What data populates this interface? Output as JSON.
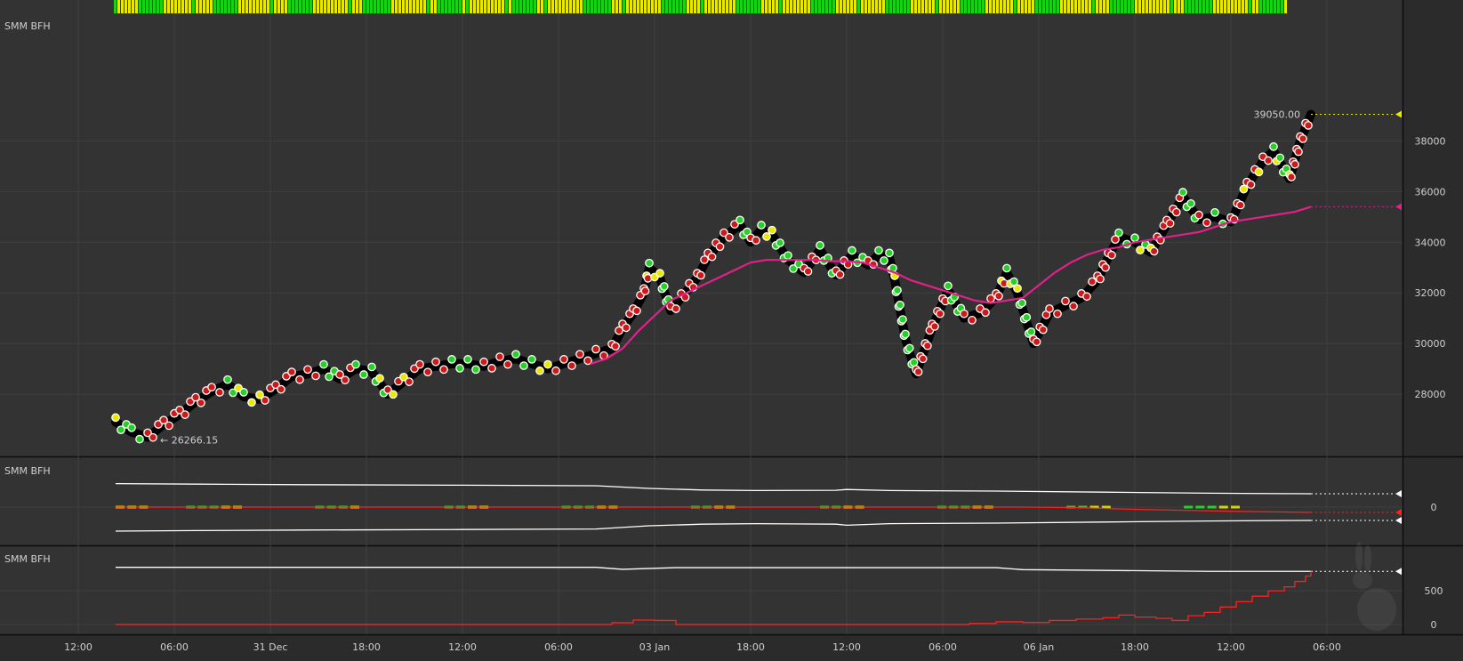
{
  "colors": {
    "background": "#2b2b2b",
    "panel": "#333333",
    "grid": "#3f3f3f",
    "axis_text": "#cfcfcf",
    "price_wick": "#000000",
    "ma_line": "#e0218a",
    "band_line": "#ffffff",
    "osc_red": "#ff2020",
    "osc_green": "#27d027",
    "osc_yellow": "#d4d400",
    "marker_green": "#27d027",
    "marker_red": "#cc1a1a",
    "marker_yellow": "#e8e800",
    "heat_yellow": "#e8e800",
    "heat_green": "#14d414",
    "last_price_arrow": "#e8e800"
  },
  "panels": [
    {
      "label": "SMM BFH"
    },
    {
      "label": "SMM BFH"
    },
    {
      "label": "SMM BFH"
    }
  ],
  "x_axis": {
    "labels": [
      "12:00",
      "06:00",
      "31 Dec",
      "18:00",
      "12:00",
      "06:00",
      "03 Jan",
      "18:00",
      "12:00",
      "06:00",
      "06 Jan",
      "18:00",
      "12:00",
      "06:00"
    ],
    "hours": [
      -12,
      6,
      24,
      42,
      60,
      78,
      96,
      114,
      132,
      150,
      168,
      186,
      204,
      222
    ]
  },
  "chart_data": [
    {
      "type": "line",
      "title": "SMM BFH",
      "x_unit": "hours since 30 Dec 00:00",
      "ylim": [
        26000,
        39700
      ],
      "y_ticks": [
        28000,
        30000,
        32000,
        34000,
        36000,
        38000
      ],
      "y_tick_labels": [
        "28000",
        "30000",
        "32000",
        "34000",
        "36000",
        "38000"
      ],
      "series": [
        {
          "role": "price",
          "x": [
            -5,
            -2,
            1,
            4,
            7,
            10,
            13,
            16,
            19,
            22,
            25,
            28,
            31,
            34,
            37,
            40,
            43,
            46,
            49,
            52,
            55,
            58,
            61,
            64,
            67,
            70,
            73,
            76,
            79,
            82,
            85,
            88,
            90,
            92,
            94,
            95,
            97,
            99,
            101,
            104,
            106,
            109,
            112,
            114,
            116,
            118,
            121,
            124,
            127,
            130,
            133,
            136,
            138,
            140,
            141,
            143,
            145,
            148,
            151,
            154,
            157,
            160,
            162,
            164,
            167,
            170,
            173,
            176,
            179,
            181,
            183,
            186,
            189,
            192,
            195,
            198,
            201,
            204,
            207,
            210,
            212,
            215,
            217,
            219
          ],
          "values": [
            26900,
            26500,
            26300,
            26800,
            27200,
            27700,
            28100,
            28400,
            27900,
            27800,
            28200,
            28700,
            28800,
            29000,
            28600,
            29000,
            28900,
            28000,
            28500,
            29000,
            29100,
            29200,
            29200,
            29100,
            29300,
            29400,
            29200,
            29000,
            29200,
            29400,
            29600,
            29800,
            30600,
            31200,
            32000,
            33000,
            32600,
            31300,
            31800,
            32600,
            33400,
            34200,
            34700,
            34000,
            34500,
            34300,
            33300,
            32800,
            33700,
            32700,
            33500,
            33100,
            33500,
            33400,
            32500,
            30200,
            28800,
            30600,
            32100,
            31000,
            31200,
            31800,
            32800,
            32000,
            30000,
            31200,
            31500,
            31800,
            32500,
            33400,
            34200,
            34000,
            33600,
            34700,
            35800,
            34900,
            35000,
            34800,
            36200,
            37200,
            37600,
            36500,
            38000,
            39050
          ]
        },
        {
          "role": "moving_average",
          "x": [
            84,
            87,
            90,
            93,
            96,
            99,
            102,
            105,
            108,
            111,
            114,
            117,
            120,
            123,
            126,
            129,
            132,
            135,
            138,
            141,
            144,
            147,
            150,
            153,
            156,
            159,
            162,
            165,
            168,
            171,
            174,
            177,
            180,
            183,
            186,
            189,
            192,
            195,
            198,
            201,
            204,
            207,
            210,
            213,
            216,
            219
          ],
          "values": [
            29200,
            29400,
            29800,
            30500,
            31100,
            31700,
            32000,
            32300,
            32600,
            32900,
            33200,
            33300,
            33300,
            33300,
            33300,
            33250,
            33250,
            33200,
            33000,
            32800,
            32500,
            32300,
            32100,
            31900,
            31700,
            31600,
            31700,
            31800,
            32300,
            32800,
            33200,
            33500,
            33700,
            33800,
            34000,
            34100,
            34200,
            34300,
            34400,
            34600,
            34800,
            34900,
            35000,
            35100,
            35200,
            35400
          ]
        }
      ],
      "annotations": {
        "last_price": {
          "value": 39050,
          "label": "39050.00"
        },
        "low_price": {
          "value": 26266.15,
          "label": "← 26266.15",
          "x": 1
        }
      }
    },
    {
      "type": "line",
      "title": "SMM BFH",
      "ylim": [
        -1,
        1
      ],
      "y_ticks": [
        0
      ],
      "y_tick_labels": [
        "0"
      ],
      "series": [
        {
          "role": "upper_band",
          "x": [
            -5,
            10,
            30,
            60,
            85,
            95,
            105,
            115,
            130,
            132,
            140,
            160,
            180,
            200,
            219
          ],
          "values": [
            0.88,
            0.86,
            0.84,
            0.82,
            0.8,
            0.7,
            0.64,
            0.62,
            0.63,
            0.66,
            0.62,
            0.6,
            0.56,
            0.52,
            0.5
          ]
        },
        {
          "role": "lower_band",
          "x": [
            -5,
            10,
            30,
            60,
            85,
            95,
            105,
            115,
            130,
            132,
            140,
            160,
            180,
            200,
            219
          ],
          "values": [
            -0.9,
            -0.88,
            -0.86,
            -0.84,
            -0.82,
            -0.7,
            -0.64,
            -0.62,
            -0.64,
            -0.68,
            -0.62,
            -0.6,
            -0.56,
            -0.52,
            -0.5
          ]
        },
        {
          "role": "oscillator",
          "x": [
            -5,
            165,
            175,
            185,
            195,
            205,
            212,
            219
          ],
          "values": [
            0,
            0,
            -0.02,
            -0.08,
            -0.12,
            -0.16,
            -0.18,
            -0.2
          ]
        }
      ]
    },
    {
      "type": "line",
      "title": "SMM BFH",
      "ylim": [
        -80,
        1150
      ],
      "y_ticks": [
        0,
        500
      ],
      "y_tick_labels": [
        "0",
        "500"
      ],
      "series": [
        {
          "role": "ceiling",
          "x": [
            -5,
            85,
            90,
            100,
            160,
            165,
            200,
            219
          ],
          "values": [
            850,
            850,
            820,
            845,
            845,
            815,
            790,
            790
          ]
        },
        {
          "role": "counter",
          "x": [
            -5,
            84,
            88,
            92,
            96,
            100,
            130,
            150,
            155,
            160,
            165,
            170,
            175,
            180,
            183,
            186,
            190,
            193,
            196,
            199,
            202,
            205,
            208,
            211,
            214,
            216,
            218,
            219
          ],
          "values": [
            0,
            0,
            25,
            65,
            60,
            0,
            0,
            0,
            15,
            40,
            30,
            60,
            80,
            100,
            140,
            110,
            90,
            60,
            130,
            180,
            260,
            340,
            420,
            500,
            560,
            640,
            720,
            790
          ]
        }
      ]
    }
  ]
}
